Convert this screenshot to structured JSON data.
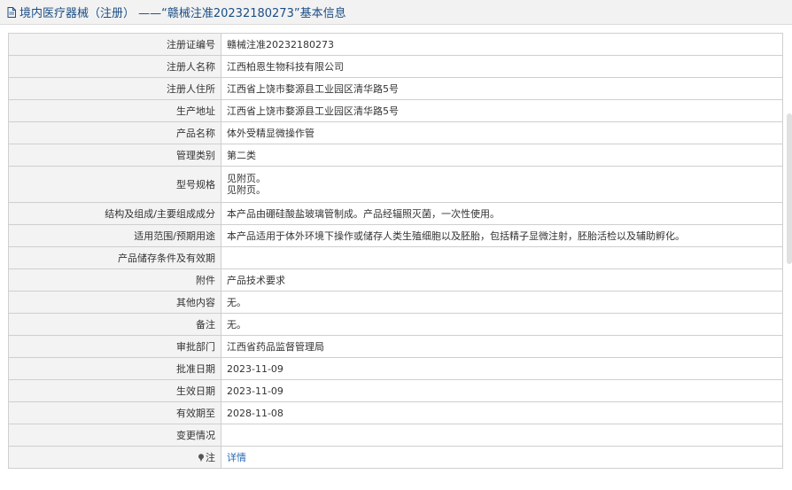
{
  "header": {
    "title": "境内医疗器械（注册） ——“赣械注准20232180273”基本信息",
    "icon": "document-icon"
  },
  "rows": [
    {
      "label": "注册证编号",
      "value": "赣械注准20232180273"
    },
    {
      "label": "注册人名称",
      "value": "江西柏恩生物科技有限公司"
    },
    {
      "label": "注册人住所",
      "value": "江西省上饶市婺源县工业园区清华路5号"
    },
    {
      "label": "生产地址",
      "value": "江西省上饶市婺源县工业园区清华路5号"
    },
    {
      "label": "产品名称",
      "value": "体外受精显微操作管"
    },
    {
      "label": "管理类别",
      "value": "第二类"
    },
    {
      "label": "型号规格",
      "value_lines": [
        "见附页。",
        "见附页。"
      ]
    },
    {
      "label": "结构及组成/主要组成成分",
      "value": "本产品由硼硅酸盐玻璃管制成。产品经辐照灭菌，一次性使用。"
    },
    {
      "label": "适用范围/预期用途",
      "value": "本产品适用于体外环境下操作或储存人类生殖细胞以及胚胎，包括精子显微注射，胚胎活检以及辅助孵化。"
    },
    {
      "label": "产品储存条件及有效期",
      "value": ""
    },
    {
      "label": "附件",
      "value": "产品技术要求"
    },
    {
      "label": "其他内容",
      "value": "无。"
    },
    {
      "label": "备注",
      "value": "无。"
    },
    {
      "label": "审批部门",
      "value": "江西省药品监督管理局"
    },
    {
      "label": "批准日期",
      "value": "2023-11-09"
    },
    {
      "label": "生效日期",
      "value": "2023-11-09"
    },
    {
      "label": "有效期至",
      "value": "2028-11-08"
    },
    {
      "label": "变更情况",
      "value": ""
    },
    {
      "label": "注",
      "label_icon": "pin-icon",
      "link": "详情"
    }
  ]
}
